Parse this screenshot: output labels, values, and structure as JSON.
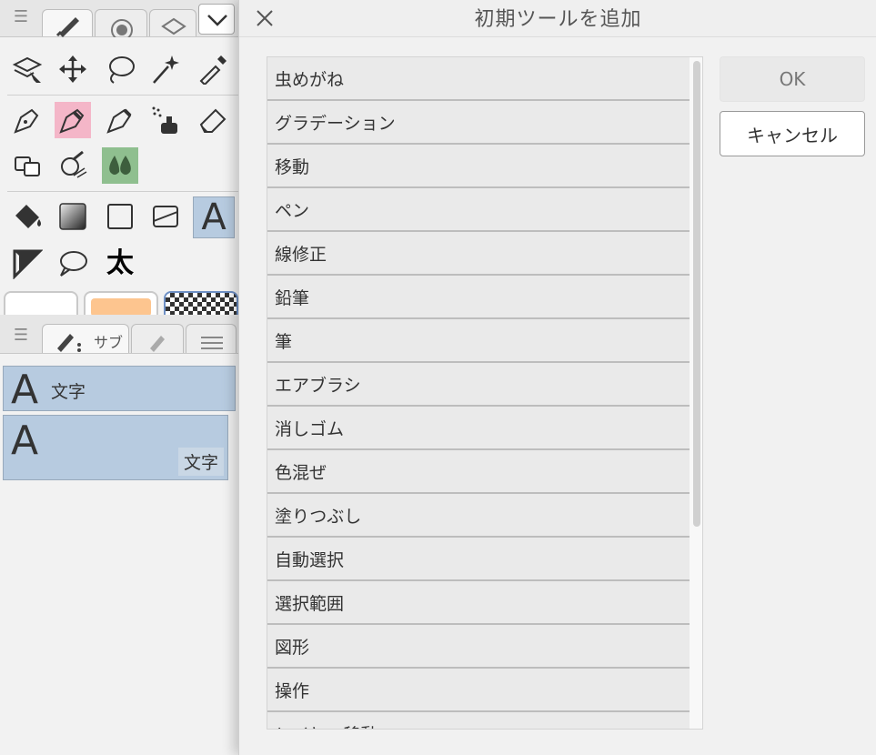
{
  "dialog": {
    "title": "初期ツールを追加",
    "ok_label": "OK",
    "cancel_label": "キャンセル",
    "items": [
      "虫めがね",
      "グラデーション",
      "移動",
      "ペン",
      "線修正",
      "鉛筆",
      "筆",
      "エアブラシ",
      "消しゴム",
      "色混ぜ",
      "塗りつぶし",
      "自動選択",
      "選択範囲",
      "図形",
      "操作",
      "レイヤー移動"
    ]
  },
  "left_panel": {
    "bold_glyph": "太",
    "subtool_tab_label": "サブ",
    "subtool_item_1_label": "文字",
    "subtool_item_2_label": "文字",
    "text_tool_glyph": "A"
  },
  "colors": {
    "selected_tool_bg": "#b7cbe0",
    "pink_tool_bg": "#f4b6c8",
    "green_tool_bg": "#8fbf8f",
    "orange_swatch": "#fdc58f"
  }
}
